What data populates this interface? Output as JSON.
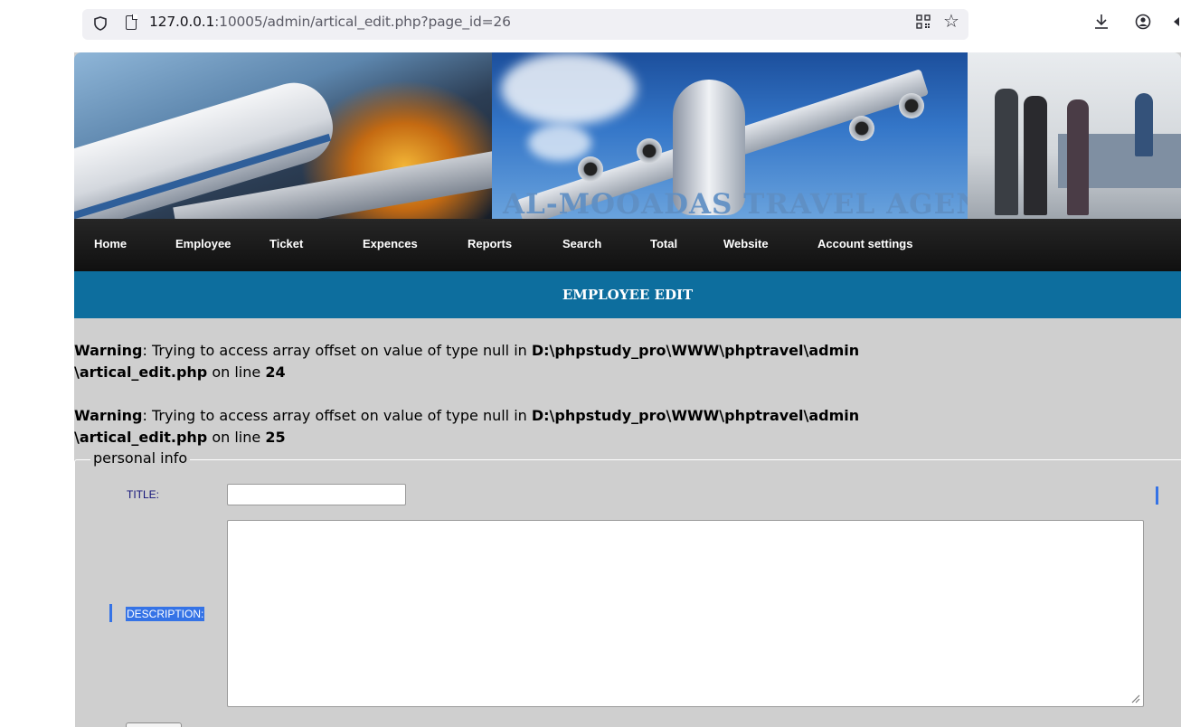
{
  "browser": {
    "url_host": "127.0.0.1",
    "url_rest": ":10005/admin/artical_edit.php?page_id=26",
    "icons": [
      "shield-icon",
      "page-icon",
      "qr-code-icon",
      "bookmark-star-icon",
      "download-icon",
      "account-icon",
      "extensions-icon"
    ]
  },
  "banner": {
    "brand_text": "AL-MOOADAS TRAVEL AGENCY"
  },
  "nav": {
    "items": [
      "Home",
      "Employee",
      "Ticket",
      "Expences",
      "Reports",
      "Search",
      "Total",
      "Website",
      "Account settings"
    ]
  },
  "page": {
    "title": "EMPLOYEE EDIT"
  },
  "warnings": [
    {
      "label": "Warning",
      "message": ": Trying to access array offset on value of type null in ",
      "path_line1": "D:\\phpstudy_pro\\WWW\\phptravel\\admin",
      "path_line2": "\\artical_edit.php",
      "on_line": " on line ",
      "line_no": "24"
    },
    {
      "label": "Warning",
      "message": ": Trying to access array offset on value of type null in ",
      "path_line1": "D:\\phpstudy_pro\\WWW\\phptravel\\admin",
      "path_line2": "\\artical_edit.php",
      "on_line": " on line ",
      "line_no": "25"
    }
  ],
  "form": {
    "legend": "personal info",
    "title_label": "TITLE:",
    "title_value": "",
    "description_label": "DESCRIPTION:",
    "description_value": ""
  },
  "colors": {
    "nav_bg": "#161616",
    "title_bar": "#0d6e9e",
    "content_bg": "#cfcfcf",
    "label_text": "#14147a",
    "selection": "#3573e6"
  }
}
